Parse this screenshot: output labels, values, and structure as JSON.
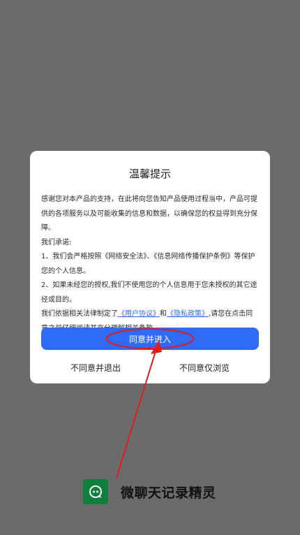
{
  "dialog": {
    "title": "温馨提示",
    "paragraph1": "感谢您对本产品的支持，在此将向您告知产品使用过程当中，产品可提供的各项服务以及可能收集的信息和数据，以确保您的权益得到充分保障。",
    "paragraph2": "我们承诺:",
    "paragraph3": "1、我们会严格按照《网络安全法》、《信息网络传播保护条例》等保护您的个人信息。",
    "paragraph4": "2、如果未经您的授权,我们不使用您的个人信息用于您未授权的其它途径或目的。",
    "paragraph5_prefix": "我们依据相关法律制定了",
    "user_agreement_link": "《用户协议》",
    "and_text": "和",
    "privacy_policy_link": "《隐私政策》",
    "paragraph5_suffix": ",请您在点击同意之前仔细阅读并充分理解相关条款。",
    "agree_button_label": "同意并进入",
    "disagree_exit_label": "不同意并退出",
    "disagree_browse_label": "不同意仅浏览"
  },
  "brand": {
    "name": "微聊天记录精灵"
  },
  "annotation": {
    "color": "#e21b1b"
  }
}
